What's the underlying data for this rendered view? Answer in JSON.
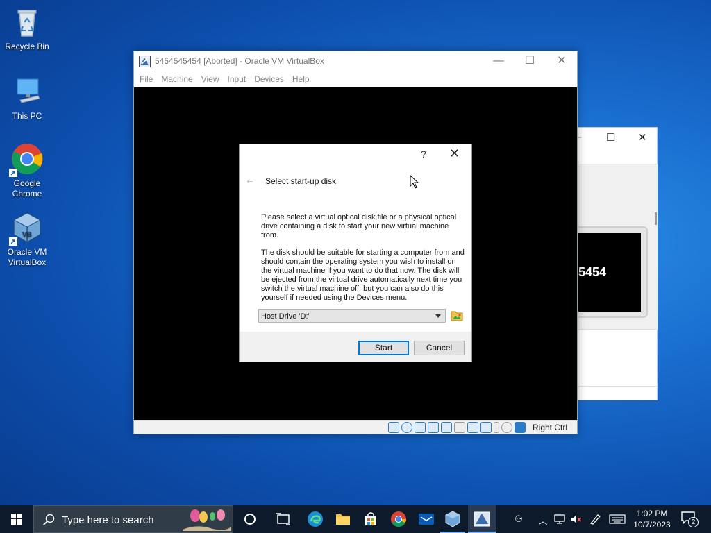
{
  "desktop": {
    "icons": [
      {
        "label": "Recycle Bin",
        "icon": "recycle-bin-icon"
      },
      {
        "label": "This PC",
        "icon": "this-pc-icon"
      },
      {
        "label": "Google Chrome",
        "icon": "chrome-icon"
      },
      {
        "label": "Oracle VM VirtualBox",
        "icon": "virtualbox-icon"
      }
    ]
  },
  "background_window": {
    "preview_text": "5454",
    "controls": {
      "maximize": "☐",
      "close": "✕"
    }
  },
  "vm_window": {
    "title": "5454545454 [Aborted] - Oracle VM VirtualBox",
    "controls": {
      "minimize": "—",
      "maximize": "☐",
      "close": "✕"
    },
    "menu": [
      "File",
      "Machine",
      "View",
      "Input",
      "Devices",
      "Help"
    ],
    "status_host_key": "Right Ctrl"
  },
  "dialog": {
    "help": "?",
    "close": "✕",
    "back": "←",
    "title": "Select start-up disk",
    "paragraph1": "Please select a virtual optical disk file or a physical optical drive containing a disk to start your new virtual machine from.",
    "paragraph2": "The disk should be suitable for starting a computer from and should contain the operating system you wish to install on the virtual machine if you want to do that now. The disk will be ejected from the virtual drive automatically next time you switch the virtual machine off, but you can also do this yourself if needed using the Devices menu.",
    "drive_selected": "Host Drive 'D:'",
    "start_button": "Start",
    "cancel_button": "Cancel"
  },
  "taskbar": {
    "search_placeholder": "Type here to search",
    "time": "1:02 PM",
    "date": "10/7/2023",
    "notification_count": "2"
  },
  "colors": {
    "desktop_blue": "#1a6fd0",
    "taskbar": "#0c1a2b",
    "accent": "#0078d7"
  }
}
